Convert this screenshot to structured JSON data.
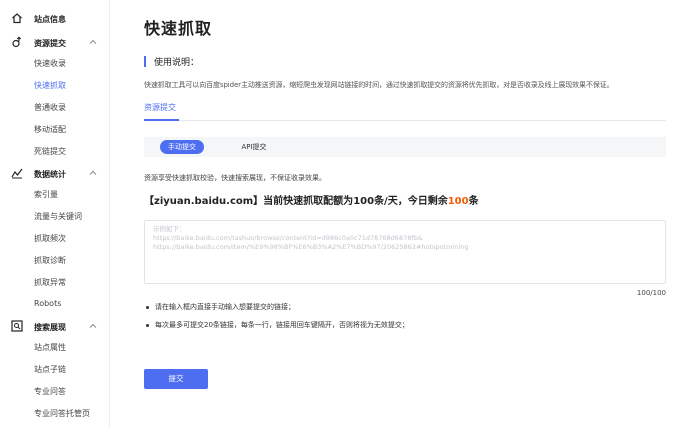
{
  "sidebar": {
    "site_info": "站点信息",
    "resource_submit": {
      "label": "资源提交",
      "items": [
        "快速收录",
        "快速抓取",
        "普通收录",
        "移动适配",
        "死链提交"
      ]
    },
    "data_stats": {
      "label": "数据统计",
      "items": [
        "索引量",
        "流量与关键词",
        "抓取频次",
        "抓取诊断",
        "抓取异常",
        "Robots"
      ]
    },
    "search_display": {
      "label": "搜索展现",
      "items": [
        "站点属性",
        "站点子链",
        "专业问答",
        "专业问答托管页"
      ]
    },
    "active_item": "快速抓取"
  },
  "main": {
    "title": "快速抓取",
    "usage_heading": "使用说明：",
    "usage_desc": "快速抓取工具可以向百度spider主动推送资源，缩短爬虫发现网站链接的时间，通过快速抓取提交的资源将优先抓取，对是否收录及线上展现效果不保证。",
    "tab": "资源提交",
    "modes": {
      "manual": "手动提交",
      "api": "API提交"
    },
    "quota_note": "资源享受快速抓取校验，快速搜索展现，不保证收录效果。",
    "quota": {
      "prefix": "【ziyuan.baidu.com】当前快速抓取配额为",
      "quota_value": "100",
      "middle": "条/天，今日剩余",
      "remaining_value": "100",
      "suffix": "条"
    },
    "textarea_placeholder": "示例如下：\nhttps://baike.baidu.com/tashuo/browse/content?id=d986c0a0c71d78768d6878fb&\nhttps://baike.baidu.com/item/%E9%98%BF%E6%B3%A2%E7%BD%97/20625862#hotspotmining",
    "counter": "100/100",
    "notes": [
      "请在输入框内直接手动输入想要提交的链接；",
      "每次最多可提交20条链接，每条一行，链接用回车键隔开，否则将视为无效提交；"
    ],
    "submit_label": "提交"
  },
  "colors": {
    "accent": "#4e6ef2",
    "highlight": "#f25c05"
  }
}
